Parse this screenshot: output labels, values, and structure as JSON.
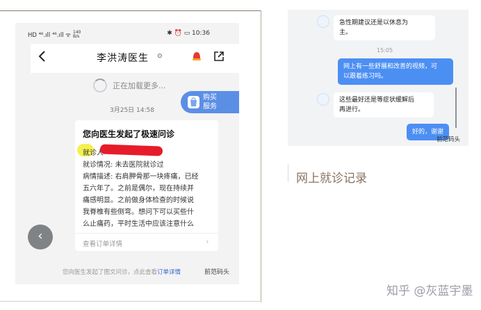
{
  "phone": {
    "status": {
      "left_text": "HD ⁴⁶.ıll ⁴⁶.ıll ᯤ",
      "speed": "140\nB/s",
      "right_text": "✱ ⏰ ▭ 10:36"
    },
    "nav": {
      "title": "李洪涛医生",
      "badge_icon": "⊙"
    },
    "loading_text": "正在加载更多...",
    "buy_service": {
      "line1": "购买",
      "line2": "服务"
    },
    "date": "3月25日 14:58",
    "card": {
      "title": "您向医生发起了极速问诊",
      "line_patient_label": "就诊人",
      "line_visit": "就诊情况: 未去医院就诊过",
      "line_desc1": "病情描述: 右肩胛骨那一块疼痛，已经",
      "line_desc2": "五六年了。之前是偶尔，现在持续并",
      "line_desc3": "痛感明显。之前做身体检查的时候说",
      "line_desc4": "我脊椎有些侧弯。想问下可以买些什",
      "line_desc5": "么止痛药，平时生活中应该注意什么",
      "footer": "查看订单详情"
    },
    "bottom_note_prefix": "您向医生发起了图文问诊，点此查看",
    "bottom_note_link": "订单详情",
    "watermark": "前范码头"
  },
  "chat": {
    "messages": [
      {
        "side": "in",
        "line1": "急性期建议还是以休息为",
        "line2": "主。"
      },
      {
        "time": "15:05"
      },
      {
        "side": "out",
        "line1": "网上有一些舒展和改善的视频，可",
        "line2": "以跟着练习吗。"
      },
      {
        "side": "in",
        "line1": "这些最好还是等症状缓解后",
        "line2": "再进行。"
      },
      {
        "side": "out",
        "line1": "好的，谢谢"
      }
    ],
    "watermark": "前范码头"
  },
  "caption": "网上就诊记录",
  "zhihu_watermark": "知乎 @灰蓝宇墨",
  "colors": {
    "accent_blue": "#4c8ff3",
    "highlight_yellow": "#f3f050",
    "redaction_red": "#e61c2a",
    "caption_brown": "#8a7260"
  }
}
